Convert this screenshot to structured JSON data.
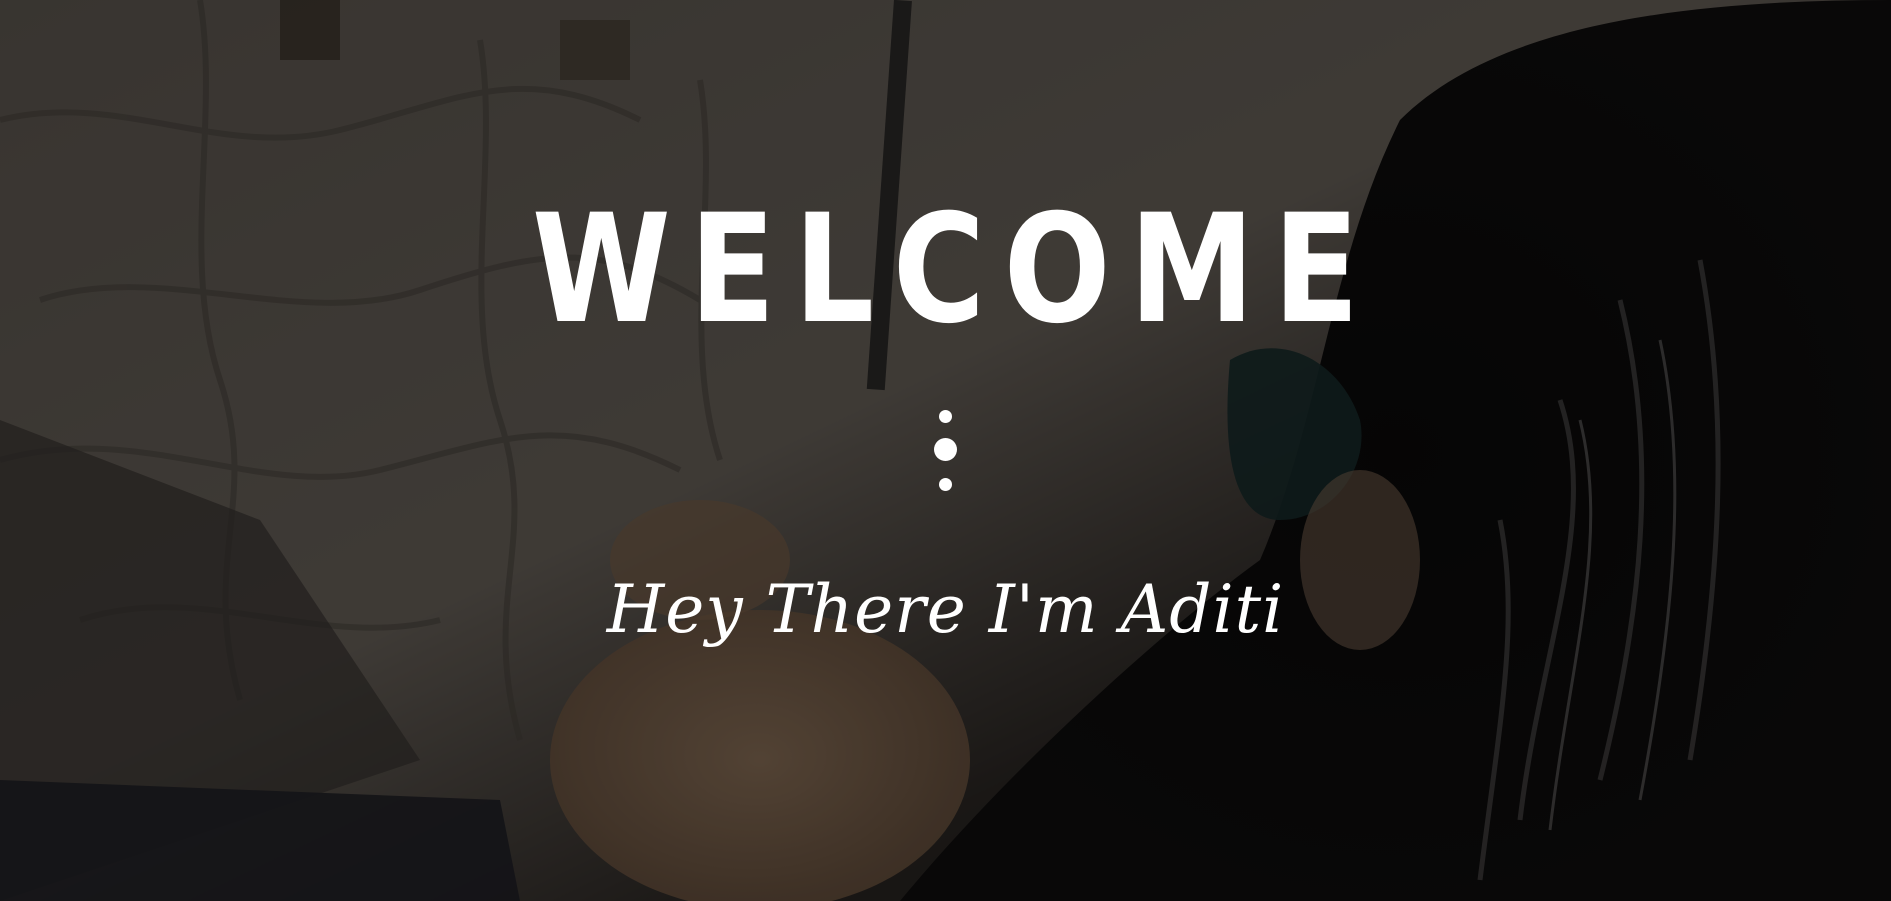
{
  "hero": {
    "title": "WELCOME",
    "subtitle": "Hey There I'm Aditi",
    "colors": {
      "text": "#ffffff",
      "overlay": "rgba(0,0,0,0.55)"
    },
    "background": {
      "description_icon": "photo-background"
    },
    "divider_icon": "vertical-dots-icon"
  }
}
